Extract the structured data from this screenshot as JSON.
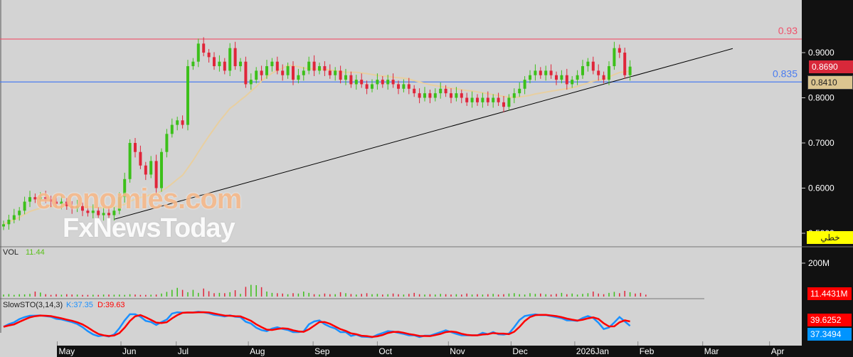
{
  "chart_data": {
    "type": "candlestick",
    "y_ticks": [
      0.9,
      0.8,
      0.7,
      0.6,
      0.5
    ],
    "y_tick_labels": [
      "0.9000",
      "0.8000",
      "0.7000",
      "0.6000",
      "0.5000"
    ],
    "ylim": [
      0.488,
      1.016
    ],
    "closes": [
      0.52,
      0.53,
      0.54,
      0.55,
      0.57,
      0.58,
      0.575,
      0.58,
      0.575,
      0.57,
      0.565,
      0.57,
      0.56,
      0.555,
      0.56,
      0.55,
      0.545,
      0.55,
      0.54,
      0.545,
      0.54,
      0.55,
      0.58,
      0.62,
      0.7,
      0.68,
      0.65,
      0.63,
      0.66,
      0.6,
      0.68,
      0.72,
      0.74,
      0.75,
      0.74,
      0.87,
      0.88,
      0.92,
      0.9,
      0.89,
      0.87,
      0.88,
      0.86,
      0.91,
      0.87,
      0.88,
      0.83,
      0.84,
      0.86,
      0.85,
      0.87,
      0.88,
      0.86,
      0.85,
      0.87,
      0.84,
      0.85,
      0.86,
      0.88,
      0.86,
      0.87,
      0.86,
      0.85,
      0.86,
      0.84,
      0.85,
      0.83,
      0.84,
      0.83,
      0.82,
      0.83,
      0.84,
      0.83,
      0.84,
      0.83,
      0.82,
      0.83,
      0.82,
      0.81,
      0.8,
      0.81,
      0.8,
      0.81,
      0.82,
      0.81,
      0.8,
      0.81,
      0.8,
      0.79,
      0.8,
      0.79,
      0.8,
      0.79,
      0.8,
      0.79,
      0.78,
      0.8,
      0.81,
      0.82,
      0.84,
      0.85,
      0.86,
      0.85,
      0.86,
      0.85,
      0.84,
      0.85,
      0.83,
      0.84,
      0.85,
      0.87,
      0.88,
      0.86,
      0.85,
      0.84,
      0.87,
      0.91,
      0.9,
      0.85,
      0.869
    ],
    "volumes_m": [
      12,
      15,
      10,
      14,
      13,
      16,
      30,
      24,
      14,
      10,
      14,
      11,
      14,
      12,
      12,
      10,
      10,
      11,
      10,
      12,
      12,
      11,
      12,
      10,
      14,
      12,
      10,
      10,
      11,
      12,
      18,
      28,
      40,
      52,
      40,
      26,
      40,
      22,
      48,
      32,
      20,
      22,
      20,
      26,
      38,
      16,
      58,
      70,
      68,
      56,
      30,
      22,
      20,
      18,
      14,
      20,
      18,
      30,
      22,
      14,
      12,
      18,
      14,
      14,
      26,
      20,
      15,
      12,
      16,
      20,
      14,
      16,
      12,
      14,
      18,
      14,
      12,
      16,
      22,
      14,
      12,
      14,
      12,
      16,
      14,
      12,
      14,
      12,
      18,
      12,
      14,
      12,
      14,
      16,
      12,
      14,
      18,
      20,
      14,
      12,
      20,
      16,
      18,
      14,
      12,
      16,
      22,
      14,
      18,
      12,
      16,
      20,
      30,
      18,
      14,
      22,
      28,
      20,
      34,
      26,
      18,
      22,
      11.44
    ],
    "x_labels": [
      {
        "label": "May",
        "index": 10.2
      },
      {
        "label": "Jun",
        "index": 22.3
      },
      {
        "label": "Jul",
        "index": 32.8
      },
      {
        "label": "Aug",
        "index": 46.5
      },
      {
        "label": "Sep",
        "index": 58.8
      },
      {
        "label": "Oct",
        "index": 71
      },
      {
        "label": "Nov",
        "index": 84.5
      },
      {
        "label": "Dec",
        "index": 96.4
      },
      {
        "label": "2026Jan",
        "index": 108.5
      },
      {
        "label": "Feb",
        "index": 120.5
      },
      {
        "label": "Mar",
        "index": 132.8
      },
      {
        "label": "Apr",
        "index": 145.5
      }
    ],
    "hlines": [
      {
        "value": 0.93,
        "label": "0.93",
        "color": "#f0506a"
      },
      {
        "value": 0.835,
        "label": "0.835",
        "color": "#4a7cf0"
      }
    ],
    "trendline": {
      "from": {
        "index": 21,
        "price": 0.531
      },
      "to": {
        "index": 138.5,
        "price": 0.909
      },
      "color": "#000000"
    },
    "ma_period": 20,
    "ma_color": "#e8cfa0",
    "up_color": "#3cc01a",
    "down_color": "#e0253a",
    "vol_tick": 200,
    "vol_tick_label": "200M",
    "stoch_k_color": "#1a90ff",
    "stoch_d_color": "#ff0000"
  },
  "tags": {
    "last_price": "0.8690",
    "ma_value": "0.8410",
    "mode": "خطي",
    "volume": "11.4431M",
    "stoch_d": "39.6252",
    "stoch_k": "37.3494"
  },
  "volume_pane": {
    "title": "VOL",
    "value": "11.44"
  },
  "stoch_pane": {
    "title": "SlowSTO(3,14,3)",
    "k": "K:37.35",
    "d": "D:39.63"
  },
  "watermark": {
    "line1": "economies.com",
    "line2": "FxNewsToday"
  }
}
